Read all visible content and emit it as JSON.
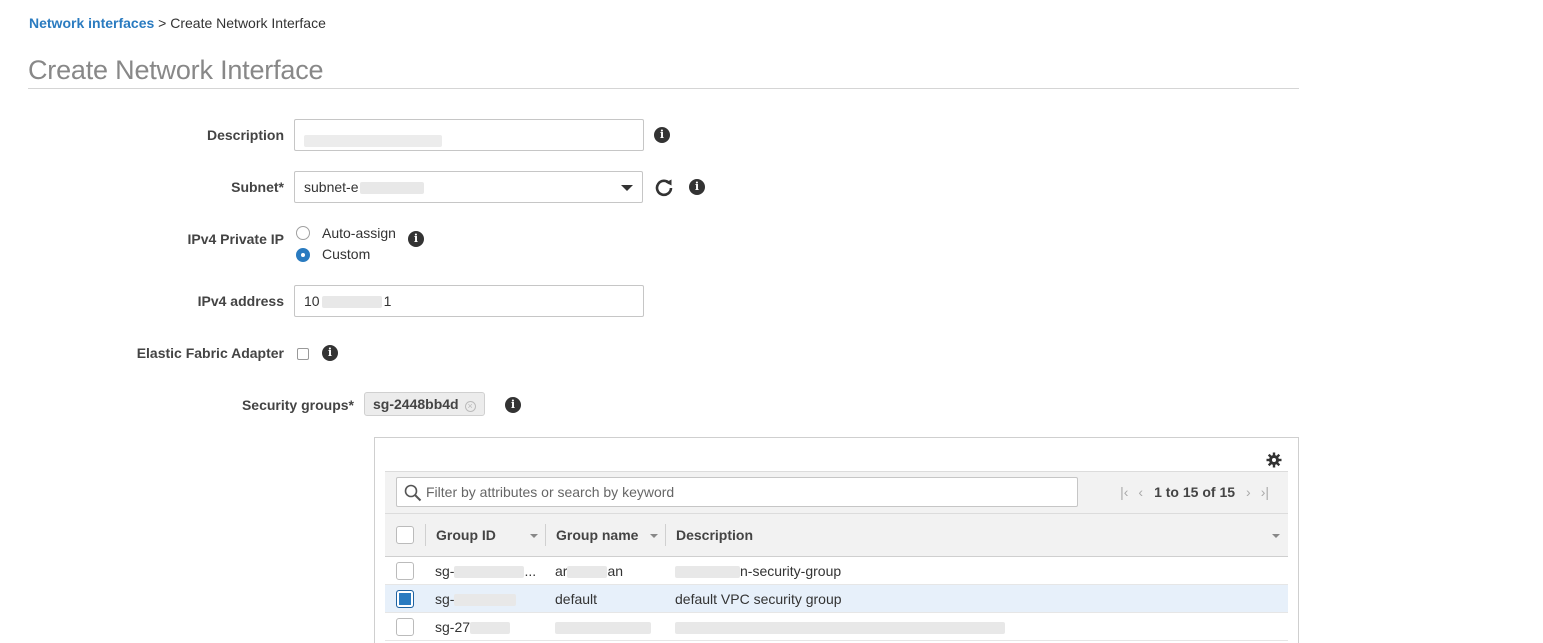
{
  "breadcrumb": {
    "link": "Network interfaces",
    "separator": " > ",
    "current": "Create Network Interface"
  },
  "page_title": "Create Network Interface",
  "form": {
    "description_label": "Description",
    "description_value": "",
    "subnet_label": "Subnet*",
    "subnet_value": "subnet-e",
    "ipv4_private_label": "IPv4 Private IP",
    "ipv4_options": [
      "Auto-assign",
      "Custom"
    ],
    "ipv4_selected": "Custom",
    "ipv4_address_label": "IPv4 address",
    "ipv4_address_prefix": "10",
    "ipv4_address_suffix": "1",
    "efa_label": "Elastic Fabric Adapter",
    "efa_checked": false,
    "security_groups_label": "Security groups*",
    "selected_sg": "sg-2448bb4d"
  },
  "sg_table": {
    "filter_placeholder": "Filter by attributes or search by keyword",
    "pagination": "1 to 15 of 15",
    "columns": [
      "Group ID",
      "Group name",
      "Description"
    ],
    "rows": [
      {
        "group_id": "sg-",
        "group_id_tail": "...",
        "group_name": "ar",
        "group_name_tail": "an",
        "description": "n-security-group",
        "checked": false
      },
      {
        "group_id": "sg-",
        "group_id_tail": "",
        "group_name": "default",
        "group_name_tail": "",
        "description": "default VPC security group",
        "checked": true
      },
      {
        "group_id": "sg-27",
        "group_id_tail": "",
        "group_name": "",
        "group_name_tail": "",
        "description": "",
        "checked": false
      }
    ]
  },
  "colors": {
    "link": "#2a7bc0",
    "selected_row": "#e7f0fa",
    "checkbox_checked": "#2a7bc0"
  }
}
